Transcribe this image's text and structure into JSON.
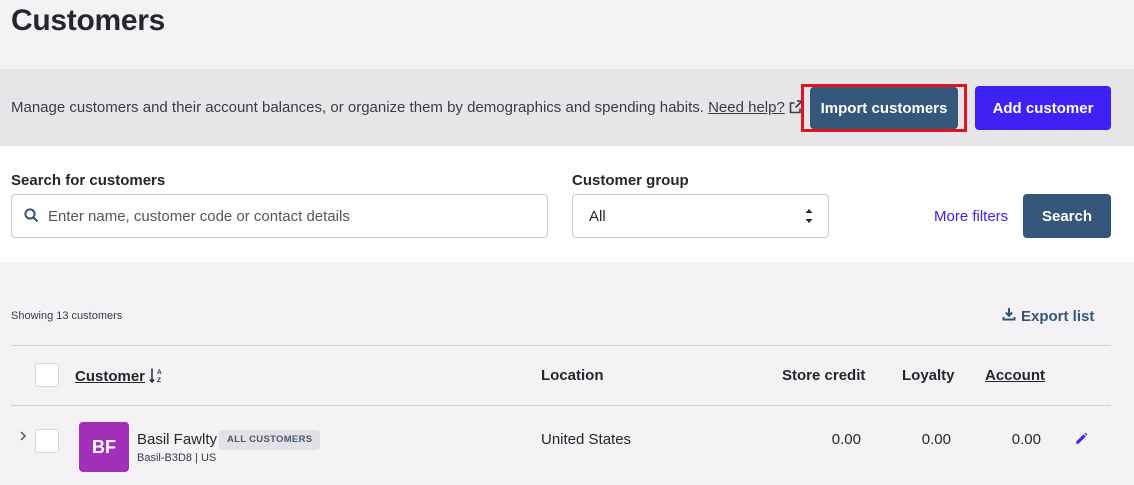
{
  "page": {
    "title": "Customers"
  },
  "banner": {
    "description": "Manage customers and their account balances, or organize them by demographics and spending habits.",
    "help_link": "Need help?",
    "import_label": "Import customers",
    "add_label": "Add customer"
  },
  "search": {
    "label": "Search for customers",
    "placeholder": "Enter name, customer code or contact details",
    "group_label": "Customer group",
    "group_value": "All",
    "more_filters": "More filters",
    "search_button": "Search"
  },
  "list": {
    "showing": "Showing 13 customers",
    "export_label": "Export list",
    "columns": {
      "customer": "Customer",
      "location": "Location",
      "store_credit": "Store credit",
      "loyalty": "Loyalty",
      "account": "Account"
    },
    "rows": [
      {
        "initials": "BF",
        "name": "Basil Fawlty",
        "badge": "ALL CUSTOMERS",
        "code": "Basil-B3D8 | US",
        "location": "United States",
        "store_credit": "0.00",
        "loyalty": "0.00",
        "account": "0.00",
        "avatar_color": "#a230b8"
      }
    ]
  },
  "colors": {
    "primary": "#35577c",
    "accent": "#3e22f5",
    "highlight": "#e0141e"
  },
  "icons": [
    "external-link-icon",
    "search-icon",
    "select-arrows-icon",
    "download-icon",
    "sort-az-icon",
    "chevron-right-icon",
    "pencil-icon"
  ]
}
